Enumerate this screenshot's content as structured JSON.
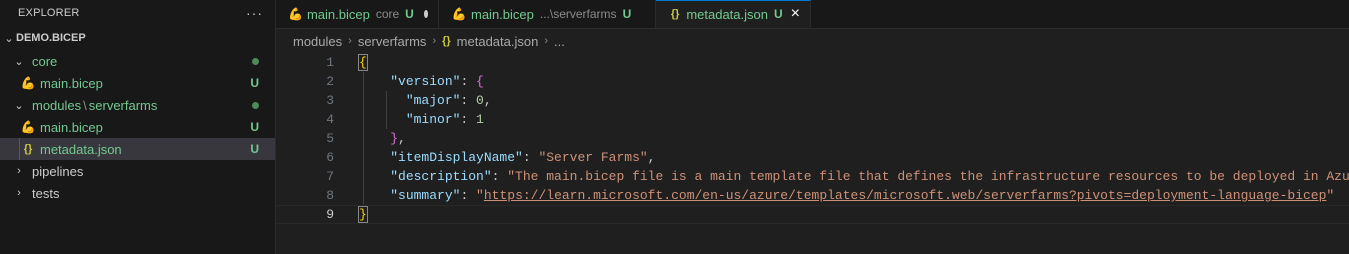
{
  "explorer": {
    "title": "EXPLORER",
    "more": "···",
    "root": "DEMO.BICEP",
    "items": [
      {
        "label": "core",
        "type": "folder",
        "status": "dot"
      },
      {
        "label": "main.bicep",
        "type": "bicep",
        "status": "U"
      },
      {
        "label_a": "modules",
        "label_sep": "\\",
        "label_b": "serverfarms",
        "type": "folder",
        "status": "dot"
      },
      {
        "label": "main.bicep",
        "type": "bicep",
        "status": "U"
      },
      {
        "label": "metadata.json",
        "type": "json",
        "status": "U"
      },
      {
        "label": "pipelines",
        "type": "folder-collapsed"
      },
      {
        "label": "tests",
        "type": "folder-collapsed"
      }
    ]
  },
  "tabs": [
    {
      "label": "main.bicep",
      "desc": "core",
      "status": "U",
      "modified": true
    },
    {
      "label": "main.bicep",
      "desc": "...\\serverfarms",
      "status": "U"
    },
    {
      "label": "metadata.json",
      "status": "U",
      "close": "×"
    }
  ],
  "breadcrumbs": [
    "modules",
    "serverfarms",
    "metadata.json",
    "..."
  ],
  "code": {
    "line_numbers": [
      "1",
      "2",
      "3",
      "4",
      "5",
      "6",
      "7",
      "8",
      "9"
    ],
    "version_key": "\"version\"",
    "major_key": "\"major\"",
    "major_val": "0",
    "minor_key": "\"minor\"",
    "minor_val": "1",
    "name_key": "\"itemDisplayName\"",
    "name_val": "\"Server Farms\"",
    "desc_key": "\"description\"",
    "desc_val": "\"The main.bicep file is a main template file that defines the infrastructure resources to be deployed in Azure.\"",
    "summary_key": "\"summary\"",
    "summary_q": "\"",
    "summary_url": "https://learn.microsoft.com/en-us/azure/templates/microsoft.web/serverfarms?pivots=deployment-language-bicep"
  },
  "colors": {
    "accent": "#0078d4",
    "untracked": "#73c991",
    "json_key": "#9cdcfe",
    "json_string": "#ce9178",
    "json_number": "#b5cea8"
  }
}
